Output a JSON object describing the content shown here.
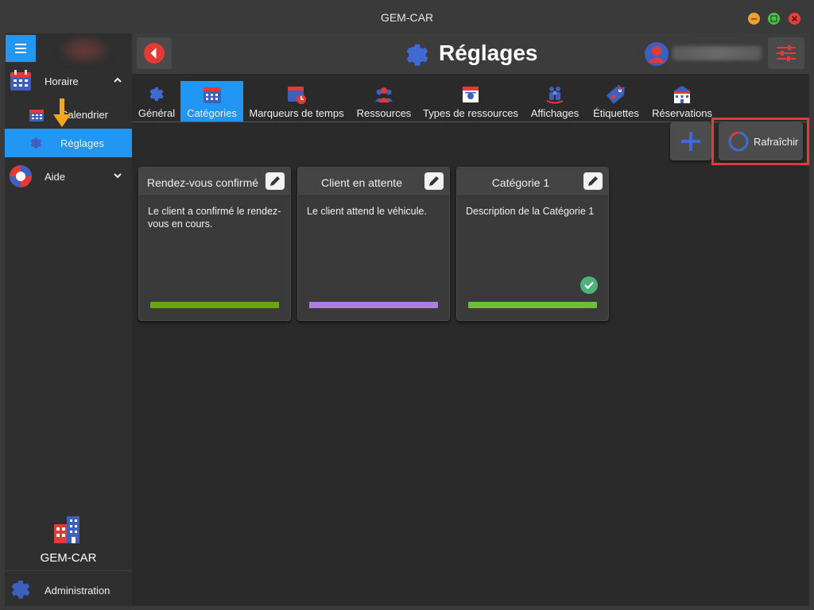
{
  "window": {
    "title": "GEM-CAR"
  },
  "colors": {
    "accent": "#2196f3",
    "highlight": "#e23b3b",
    "brand_red": "#e53935"
  },
  "sidebar": {
    "sections": [
      {
        "label": "Horaire",
        "icon": "calendar-icon",
        "expanded": true
      },
      {
        "label": "Aide",
        "icon": "lifebuoy-icon",
        "expanded": false
      }
    ],
    "sub_items": [
      {
        "label": "Calendrier",
        "icon": "calendar-small-icon",
        "active": false
      },
      {
        "label": "Réglages",
        "icon": "gear-icon",
        "active": true
      }
    ],
    "brand_name": "GEM-CAR",
    "admin_label": "Administration"
  },
  "header": {
    "title": "Réglages"
  },
  "tabs": [
    {
      "label": "Général",
      "icon": "gear-icon",
      "active": false
    },
    {
      "label": "Catégories",
      "icon": "calendar-grid-icon",
      "active": true
    },
    {
      "label": "Marqueurs de temps",
      "icon": "calendar-clock-icon",
      "active": false
    },
    {
      "label": "Ressources",
      "icon": "people-icon",
      "active": false
    },
    {
      "label": "Types de ressources",
      "icon": "id-card-icon",
      "active": false
    },
    {
      "label": "Affichages",
      "icon": "group-icon",
      "active": false
    },
    {
      "label": "Étiquettes",
      "icon": "tag-icon",
      "active": false
    },
    {
      "label": "Réservations",
      "icon": "building-icon",
      "active": false
    }
  ],
  "toolbar": {
    "refresh_label": "Rafraîchir"
  },
  "categories": [
    {
      "title": "Rendez-vous confirmé",
      "description": "Le client a confirmé le rendez-vous en cours.",
      "color": "#6aa513",
      "default": false
    },
    {
      "title": "Client en attente",
      "description": "Le client attend le véhicule.",
      "color": "#b07ee0",
      "default": false
    },
    {
      "title": "Catégorie 1",
      "description": "Description de la Catégorie 1",
      "color": "#6fbf3a",
      "default": true
    }
  ]
}
